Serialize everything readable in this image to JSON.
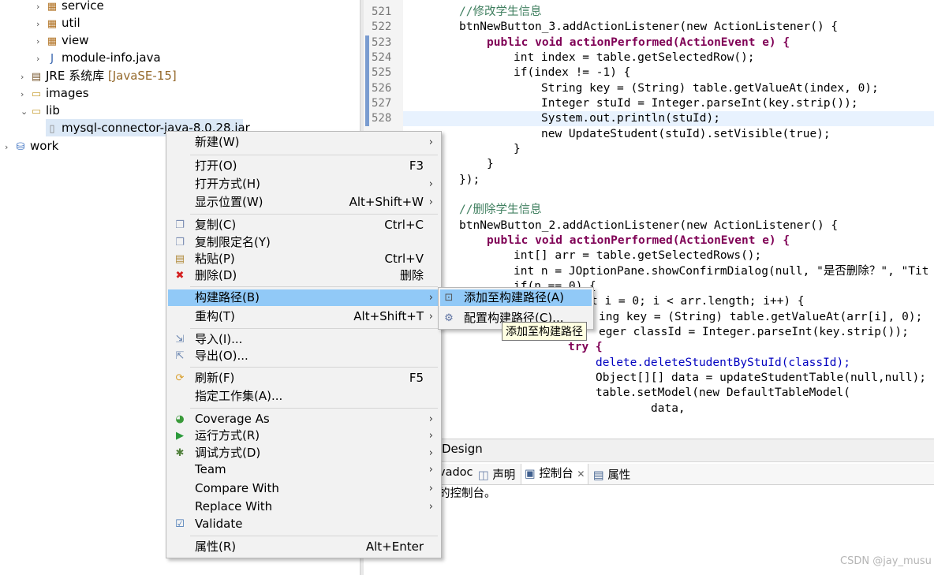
{
  "explorer": {
    "items": [
      {
        "label": "service"
      },
      {
        "label": "util"
      },
      {
        "label": "view"
      },
      {
        "label": "module-info.java"
      },
      {
        "label": "JRE 系统库",
        "extra": "[JavaSE-15]"
      },
      {
        "label": "images"
      },
      {
        "label": "lib"
      },
      {
        "label": "mysql-connector-java-8.0.28.jar"
      },
      {
        "label": "work"
      }
    ]
  },
  "editor": {
    "line_numbers": [
      "521",
      "522",
      "523",
      "524",
      "525",
      "526",
      "527",
      "528"
    ],
    "lines": [
      "//修改学生信息",
      "btnNewButton_3.addActionListener(new ActionListener() {",
      "public void actionPerformed(ActionEvent e) {",
      "int index = table.getSelectedRow();",
      "if(index != -1) {",
      "String key = (String) table.getValueAt(index, 0);",
      "Integer stuId = Integer.parseInt(key.strip());",
      "System.out.println(stuId);",
      "new UpdateStudent(stuId).setVisible(true);",
      "}",
      "}",
      "});",
      "//删除学生信息",
      "btnNewButton_2.addActionListener(new ActionListener() {",
      "public void actionPerformed(ActionEvent e) {",
      "int[] arr = table.getSelectedRows();",
      "int n = JOptionPane.showConfirmDialog(null, \"是否删除？\", \"Tit",
      "if(n == 0) {",
      "t i = 0; i < arr.length; i++) {",
      "ing key = (String) table.getValueAt(arr[i], 0);",
      "eger classId = Integer.parseInt(key.strip());",
      "try {",
      "delete.deleteStudentByStuId(classId);",
      "Object[][] data = updateStudentTable(null,null);",
      "table.setModel(new DefaultTableModel(",
      "data,"
    ]
  },
  "bottom": {
    "design_tab": "Design",
    "tabs": [
      "vadoc",
      "声明",
      "控制台",
      "属性"
    ],
    "console_message": "的控制台。"
  },
  "watermark": "CSDN @jay_musu",
  "context_menu": {
    "items": [
      {
        "label": "新建(W)",
        "shortcut": ""
      },
      {
        "label": "打开(O)",
        "shortcut": "F3"
      },
      {
        "label": "打开方式(H)",
        "shortcut": ""
      },
      {
        "label": "显示位置(W)",
        "shortcut": "Alt+Shift+W"
      },
      {
        "label": "复制(C)",
        "shortcut": "Ctrl+C"
      },
      {
        "label": "复制限定名(Y)",
        "shortcut": ""
      },
      {
        "label": "粘贴(P)",
        "shortcut": "Ctrl+V"
      },
      {
        "label": "删除(D)",
        "shortcut": "删除"
      },
      {
        "label": "构建路径(B)",
        "shortcut": ""
      },
      {
        "label": "重构(T)",
        "shortcut": "Alt+Shift+T"
      },
      {
        "label": "导入(I)...",
        "shortcut": ""
      },
      {
        "label": "导出(O)...",
        "shortcut": ""
      },
      {
        "label": "刷新(F)",
        "shortcut": "F5"
      },
      {
        "label": "指定工作集(A)...",
        "shortcut": ""
      },
      {
        "label": "Coverage As",
        "shortcut": ""
      },
      {
        "label": "运行方式(R)",
        "shortcut": ""
      },
      {
        "label": "调试方式(D)",
        "shortcut": ""
      },
      {
        "label": "Team",
        "shortcut": ""
      },
      {
        "label": "Compare With",
        "shortcut": ""
      },
      {
        "label": "Replace With",
        "shortcut": ""
      },
      {
        "label": "Validate",
        "shortcut": ""
      },
      {
        "label": "属性(R)",
        "shortcut": "Alt+Enter"
      }
    ],
    "submenu": [
      {
        "label": "添加至构建路径(A)"
      },
      {
        "label": "配置构建路径(C)..."
      }
    ],
    "tooltip": "添加至构建路径"
  },
  "colors": {
    "highlight": "#91c9f7",
    "keyword": "#7f0055",
    "comment": "#3f7f5f",
    "field": "#0000c0",
    "string": "#2a00ff"
  }
}
